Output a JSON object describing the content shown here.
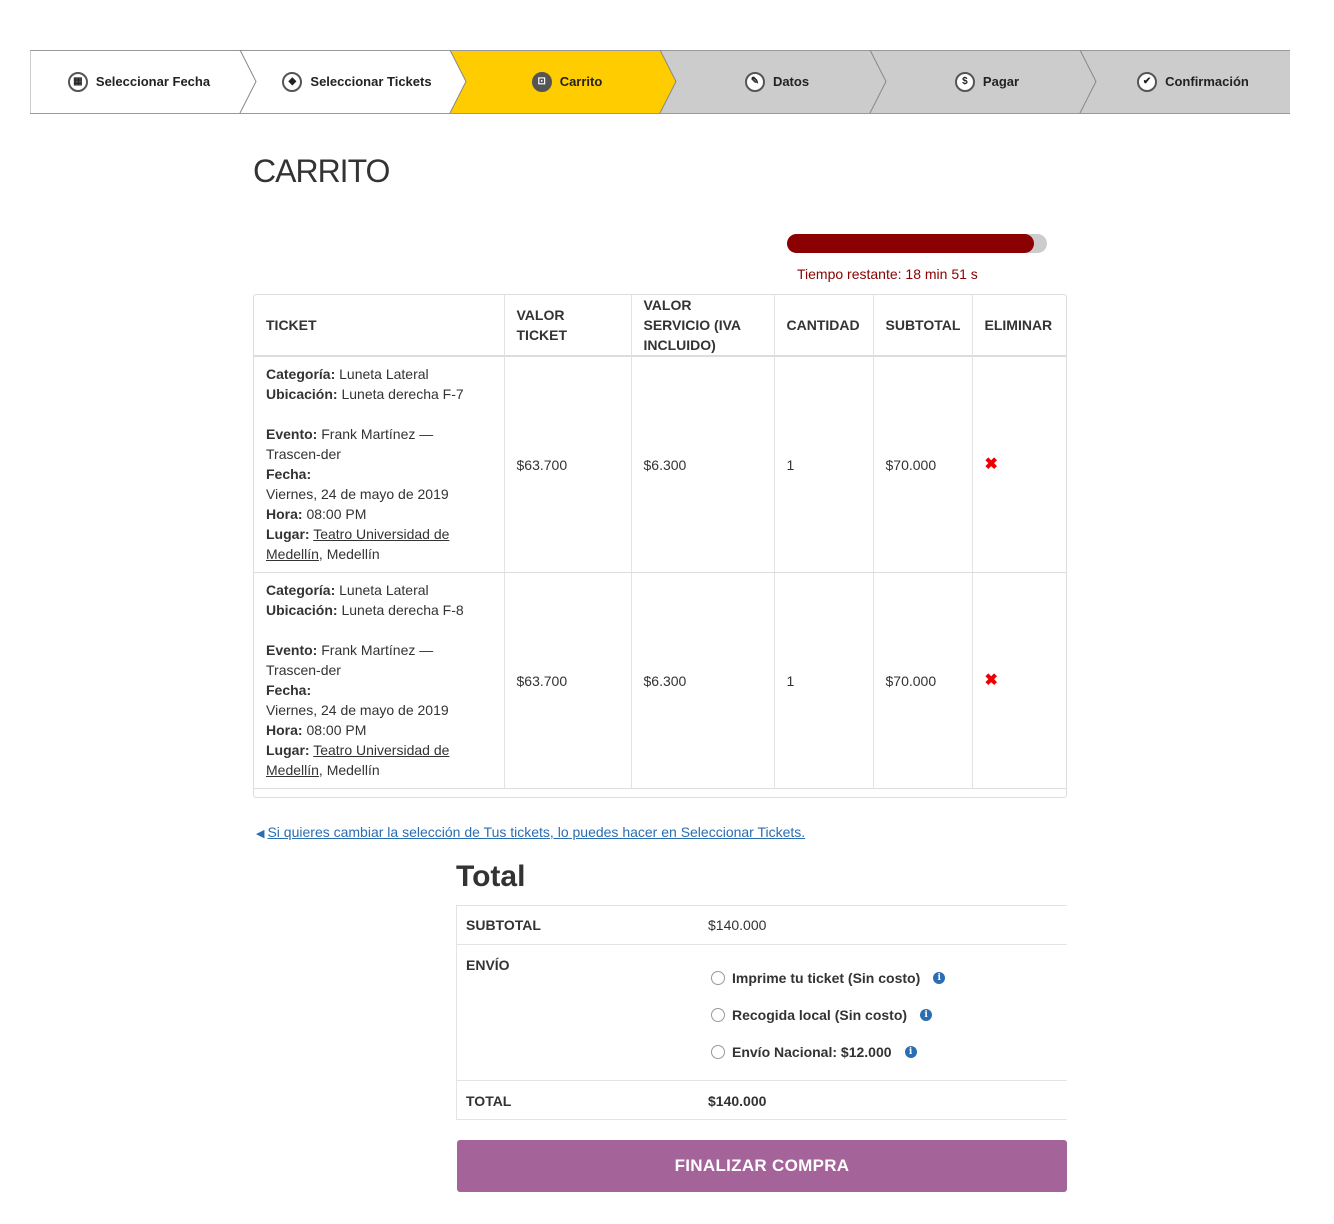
{
  "steps": [
    {
      "label": "Seleccionar Fecha",
      "icon": "calendar-icon",
      "glyph": "▦",
      "state": "done"
    },
    {
      "label": "Seleccionar Tickets",
      "icon": "tags-icon",
      "glyph": "◆",
      "state": "done"
    },
    {
      "label": "Carrito",
      "icon": "cart-icon",
      "glyph": "⊡",
      "state": "active"
    },
    {
      "label": "Datos",
      "icon": "pencil-icon",
      "glyph": "✎",
      "state": "pending"
    },
    {
      "label": "Pagar",
      "icon": "dollar-icon",
      "glyph": "$",
      "state": "pending"
    },
    {
      "label": "Confirmación",
      "icon": "check-icon",
      "glyph": "✔",
      "state": "pending"
    }
  ],
  "colors": {
    "step_done": "#ffffff",
    "step_active": "#ffcc00",
    "step_pending": "#cccccc",
    "timer_fill": "#8b0000",
    "finalize_button": "#a4649a",
    "link": "#2a6db3",
    "remove": "#ee0000"
  },
  "page_title": "CARRITO",
  "timer": {
    "text": "Tiempo restante: 18 min 51 s",
    "progress": 0.95
  },
  "cart": {
    "headers": {
      "ticket": "TICKET",
      "valor_ticket": "VALOR TICKET",
      "valor_servicio": "VALOR SERVICIO (IVA INCLUIDO)",
      "cantidad": "CANTIDAD",
      "subtotal": "SUBTOTAL",
      "eliminar": "ELIMINAR"
    },
    "labels": {
      "categoria": "Categoría:",
      "ubicacion": "Ubicación:",
      "evento": "Evento:",
      "fecha": "Fecha:",
      "hora": "Hora:",
      "lugar": "Lugar:"
    },
    "rows": [
      {
        "categoria": "Luneta Lateral",
        "ubicacion": "Luneta derecha F-7",
        "evento": "Frank Martínez — Trascen-der",
        "fecha": "Viernes, 24 de mayo de 2019",
        "hora": "08:00 PM",
        "lugar": "Teatro Universidad de Medellín",
        "ciudad": ", Medellín",
        "valor_ticket": "$63.700",
        "valor_servicio": "$6.300",
        "cantidad": "1",
        "subtotal": "$70.000",
        "remove": "✖"
      },
      {
        "categoria": "Luneta Lateral",
        "ubicacion": "Luneta derecha F-8",
        "evento": "Frank Martínez — Trascen-der",
        "fecha": "Viernes, 24 de mayo de 2019",
        "hora": "08:00 PM",
        "lugar": "Teatro Universidad de Medellín",
        "ciudad": ", Medellín",
        "valor_ticket": "$63.700",
        "valor_servicio": "$6.300",
        "cantidad": "1",
        "subtotal": "$70.000",
        "remove": "✖"
      }
    ]
  },
  "back_link": "Si quieres cambiar la selección de Tus tickets, lo puedes hacer en Seleccionar Tickets.",
  "totals": {
    "title": "Total",
    "subtotal_label": "SUBTOTAL",
    "subtotal_value": "$140.000",
    "shipping_label": "ENVÍO",
    "shipping_options": [
      {
        "label": "Imprime tu ticket (Sin costo)",
        "selected": false
      },
      {
        "label": "Recogida local (Sin costo)",
        "selected": false
      },
      {
        "label": "Envío Nacional: $12.000",
        "selected": false
      }
    ],
    "total_label": "TOTAL",
    "total_value": "$140.000"
  },
  "finalize_label": "FINALIZAR COMPRA"
}
